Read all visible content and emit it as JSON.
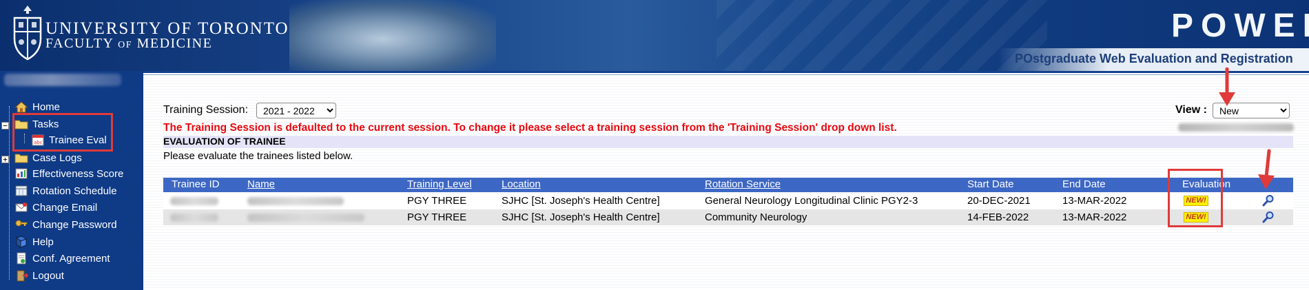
{
  "header": {
    "university_line1": "UNIVERSITY OF TORONTO",
    "university_line2_a": "FACULTY",
    "university_line2_of": "OF",
    "university_line2_b": "MEDICINE",
    "app_name": "POWER",
    "tagline": "POstgraduate Web Evaluation and Registration"
  },
  "sidebar": {
    "items": [
      {
        "label": "Home",
        "icon": "home-icon"
      },
      {
        "label": "Tasks",
        "icon": "folder-icon"
      },
      {
        "label": "Trainee Eval",
        "icon": "abc-form-icon"
      },
      {
        "label": "Case Logs",
        "icon": "folder-icon"
      },
      {
        "label": "Effectiveness Score",
        "icon": "score-icon"
      },
      {
        "label": "Rotation Schedule",
        "icon": "schedule-icon"
      },
      {
        "label": "Change Email",
        "icon": "email-icon"
      },
      {
        "label": "Change Password",
        "icon": "key-icon"
      },
      {
        "label": "Help",
        "icon": "help-book-icon"
      },
      {
        "label": "Conf. Agreement",
        "icon": "agreement-icon"
      },
      {
        "label": "Logout",
        "icon": "logout-icon"
      }
    ]
  },
  "main": {
    "training_session_label": "Training Session:",
    "training_session_value": "2021 - 2022",
    "view_label": "View :",
    "view_value": "New",
    "warning": "The Training Session is defaulted to the current session. To change it please select a training session from the 'Training Session' drop down list.",
    "section_title": "EVALUATION OF TRAINEE",
    "instructions": "Please evaluate the trainees listed below."
  },
  "table": {
    "headers": [
      "Trainee ID",
      "Name",
      "Training Level",
      "Location",
      "Rotation Service",
      "Start Date",
      "End Date",
      "Evaluation"
    ],
    "rows": [
      {
        "training_level": "PGY THREE",
        "location": "SJHC [St. Joseph's Health Centre]",
        "rotation_service": "General Neurology Longitudinal Clinic PGY2-3",
        "start_date": "20-DEC-2021",
        "end_date": "13-MAR-2022",
        "evaluation": "NEW!"
      },
      {
        "training_level": "PGY THREE",
        "location": "SJHC [St. Joseph's Health Centre]",
        "rotation_service": "Community Neurology",
        "start_date": "14-FEB-2022",
        "end_date": "13-MAR-2022",
        "evaluation": "NEW!"
      }
    ]
  },
  "colors": {
    "sidebar_bg": "#0e3a86",
    "table_header_bg": "#3d67c4",
    "warning_text": "#e8080f",
    "annotation_red": "#e03a3a",
    "new_badge_bg": "#fff200"
  }
}
